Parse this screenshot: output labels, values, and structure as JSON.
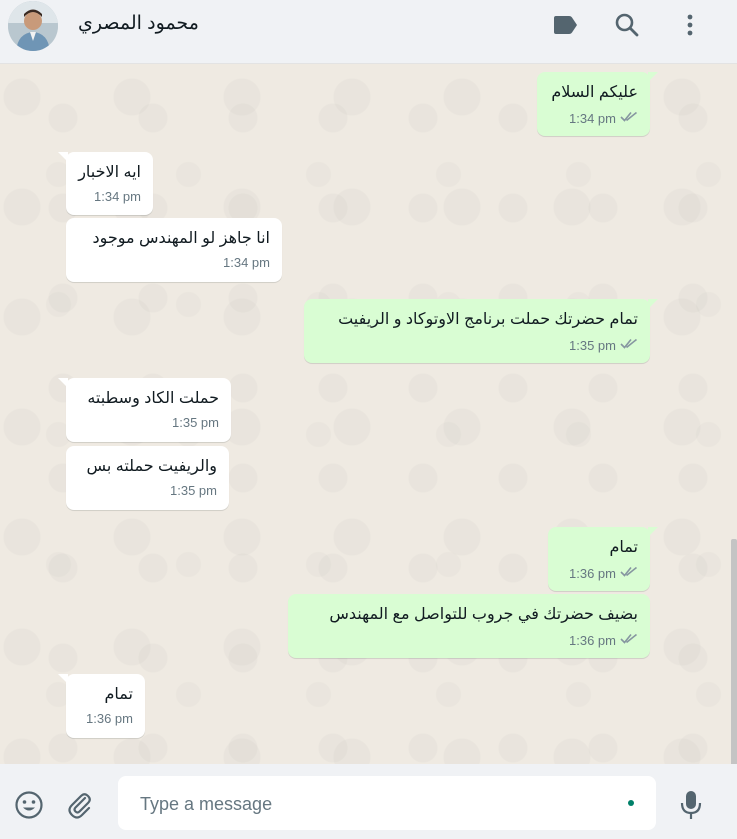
{
  "header": {
    "contact_name": "محمود المصري"
  },
  "messages": [
    {
      "dir": "out",
      "text": "عليكم السلام",
      "time": "1:34 pm"
    },
    {
      "dir": "in",
      "text": "ايه الاخبار",
      "time": "1:34 pm"
    },
    {
      "dir": "in",
      "text": "انا جاهز لو المهندس موجود",
      "time": "1:34 pm"
    },
    {
      "dir": "out",
      "text": "تمام حضرتك حملت برنامج الاوتوكاد و الريفيت",
      "time": "1:35 pm"
    },
    {
      "dir": "in",
      "text": "حملت الكاد وسطبته",
      "time": "1:35 pm"
    },
    {
      "dir": "in",
      "text": "والريفيت حملته بس",
      "time": "1:35 pm"
    },
    {
      "dir": "out",
      "text": "تمام",
      "time": "1:36 pm"
    },
    {
      "dir": "out",
      "text": "بضيف حضرتك في جروب للتواصل مع المهندس",
      "time": "1:36 pm"
    },
    {
      "dir": "in",
      "text": "تمام",
      "time": "1:36 pm"
    }
  ],
  "composer": {
    "placeholder": "Type a message",
    "value": ""
  },
  "icons": {
    "header": [
      "label-icon",
      "search-icon",
      "menu-icon"
    ],
    "footer": [
      "emoji-icon",
      "attach-icon",
      "mic-icon"
    ],
    "status": "double-check-icon"
  },
  "colors": {
    "outgoing_bubble": "#d9fdd3",
    "incoming_bubble": "#ffffff",
    "chat_background": "#efeae2",
    "header_background": "#f0f2f5",
    "read_tick": "#8696a0",
    "accent": "#008069"
  }
}
